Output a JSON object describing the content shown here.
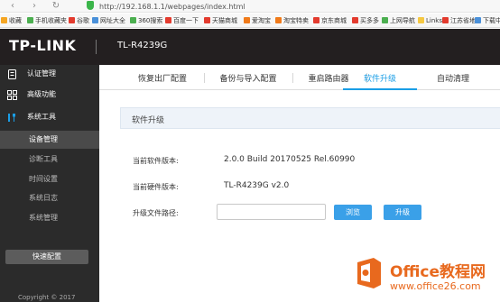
{
  "browser": {
    "back_icon": "chevron-left-icon",
    "forward_icon": "chevron-right-icon",
    "reload_icon": "reload-icon",
    "url": "http://192.168.1.1/webpages/index.html",
    "bookmarks": [
      {
        "label": "收藏",
        "color": "#f5a623"
      },
      {
        "label": "手机收藏夹",
        "color": "#4caf50"
      },
      {
        "label": "谷歌",
        "color": "#e33b2e"
      },
      {
        "label": "网址大全",
        "color": "#4a90d9"
      },
      {
        "label": "360搜索",
        "color": "#4caf50"
      },
      {
        "label": "百度一下",
        "color": "#e33b2e"
      },
      {
        "label": "天猫商城",
        "color": "#e33b2e"
      },
      {
        "label": "爱淘宝",
        "color": "#f07a1a"
      },
      {
        "label": "淘宝特卖",
        "color": "#f07a1a"
      },
      {
        "label": "京东商城",
        "color": "#e33b2e"
      },
      {
        "label": "买多多",
        "color": "#e33b2e"
      },
      {
        "label": "上网导航",
        "color": "#4caf50"
      },
      {
        "label": "Links",
        "color": "#f5c842"
      },
      {
        "label": "江苏省地",
        "color": "#e33b2e"
      },
      {
        "label": "下载中",
        "color": "#4a90d9"
      }
    ]
  },
  "header": {
    "logo": "TP-LINK",
    "model": "TL-R4239G",
    "background": "#231f20"
  },
  "sidebar": {
    "items": [
      {
        "label": "认证管理",
        "icon": "user-id-icon"
      },
      {
        "label": "高级功能",
        "icon": "grid-icon"
      },
      {
        "label": "系统工具",
        "icon": "tools-icon"
      }
    ],
    "subitems": [
      {
        "label": "设备管理",
        "active": true
      },
      {
        "label": "诊断工具",
        "active": false
      },
      {
        "label": "时间设置",
        "active": false
      },
      {
        "label": "系统日志",
        "active": false
      },
      {
        "label": "系统管理",
        "active": false
      }
    ],
    "quick_config": "快速配置",
    "copyright": "Copyright © 2017"
  },
  "tabs": [
    {
      "label": "恢复出厂配置",
      "active": false
    },
    {
      "label": "备份与导入配置",
      "active": false
    },
    {
      "label": "重启路由器",
      "active": false
    },
    {
      "label": "软件升级",
      "active": true
    },
    {
      "label": "自动清理",
      "active": false
    }
  ],
  "content": {
    "section_title": "软件升级",
    "software_version_label": "当前软件版本:",
    "software_version": "2.0.0 Build 20170525 Rel.60990",
    "hardware_version_label": "当前硬件版本:",
    "hardware_version": "TL-R4239G v2.0",
    "upgrade_file_label": "升级文件路径:",
    "upgrade_file_value": "",
    "browse_button": "浏览",
    "upgrade_button": "升级"
  },
  "watermark": {
    "text": "Office教程网",
    "url": "www.office26.com"
  },
  "colors": {
    "accent": "#1a9ee6",
    "button": "#3aa0e8",
    "sidebar": "#2b2b2b",
    "watermark": "#e8691e"
  }
}
